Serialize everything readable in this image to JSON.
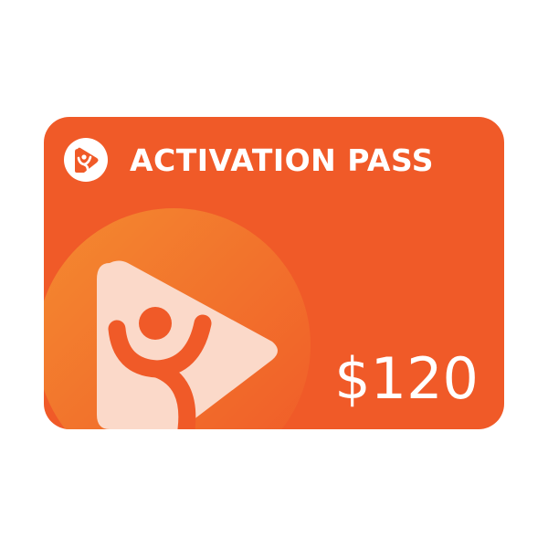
{
  "card": {
    "title": "ACTIVATION PASS",
    "amount": "$120"
  },
  "icons": {
    "header": "play-person-logo-icon",
    "large": "play-person-logo-icon"
  },
  "colors": {
    "card_background": "#f05a28",
    "circle_gradient_start": "#f3872f",
    "circle_gradient_end": "#f05a28",
    "logo_triangle": "#fbd9c9",
    "logo_figure": "#f05a28",
    "text": "#ffffff"
  }
}
